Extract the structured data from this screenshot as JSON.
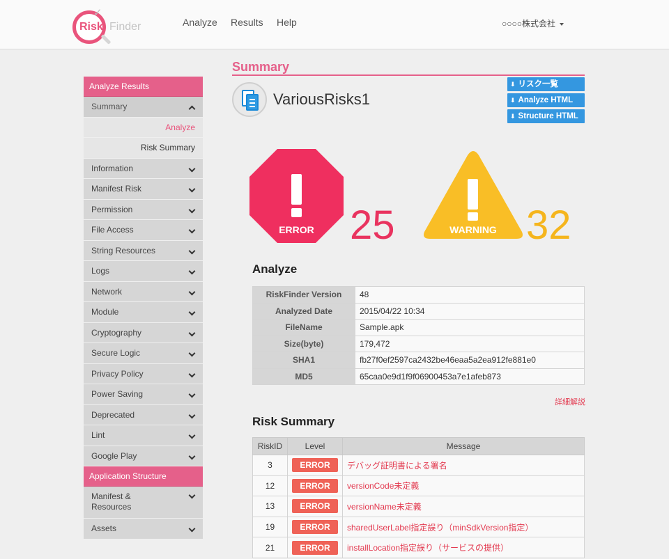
{
  "nav": {
    "logo_risk": "Risk",
    "logo_finder": "Finder",
    "links": [
      "Analyze",
      "Results",
      "Help"
    ],
    "company": "○○○○株式会社"
  },
  "sidebar": {
    "section1": "Analyze Results",
    "summary": "Summary",
    "sub_analyze": "Analyze",
    "sub_risk_summary": "Risk Summary",
    "items": [
      "Information",
      "Manifest Risk",
      "Permission",
      "File Access",
      "String Resources",
      "Logs",
      "Network",
      "Module",
      "Cryptography",
      "Secure Logic",
      "Privacy Policy",
      "Power Saving",
      "Deprecated",
      "Lint",
      "Google Play"
    ],
    "section2": "Application Structure",
    "items2": [
      "Manifest & Resources",
      "Assets"
    ]
  },
  "main": {
    "title": "Summary",
    "app_name": "VariousRisks1",
    "buttons": [
      "リスク一覧",
      "Analyze HTML",
      "Structure HTML"
    ],
    "error_label": "ERROR",
    "error_count": "25",
    "warning_label": "WARNING",
    "warning_count": "32",
    "analyze_heading": "Analyze",
    "analyze_rows": [
      {
        "key": "RiskFinder Version",
        "value": "48"
      },
      {
        "key": "Analyzed Date",
        "value": "2015/04/22 10:34"
      },
      {
        "key": "FileName",
        "value": "Sample.apk"
      },
      {
        "key": "Size(byte)",
        "value": "179,472"
      },
      {
        "key": "SHA1",
        "value": "fb27f0ef2597ca2432be46eaa5a2ea912fe881e0"
      },
      {
        "key": "MD5",
        "value": "65caa0e9d1f9f06900453a7e1afeb873"
      }
    ],
    "detail_link": "詳細解説",
    "risk_heading": "Risk Summary",
    "risk_columns": [
      "RiskID",
      "Level",
      "Message"
    ],
    "risk_rows": [
      {
        "id": "3",
        "level": "ERROR",
        "message": "デバッグ証明書による署名"
      },
      {
        "id": "12",
        "level": "ERROR",
        "message": "versionCode未定義"
      },
      {
        "id": "13",
        "level": "ERROR",
        "message": "versionName未定義"
      },
      {
        "id": "19",
        "level": "ERROR",
        "message": "sharedUserLabel指定誤り（minSdkVersion指定）"
      },
      {
        "id": "21",
        "level": "ERROR",
        "message": "installLocation指定誤り（サービスの提供）"
      }
    ]
  },
  "colors": {
    "brand_pink": "#e5608a",
    "error_red": "#e9335f",
    "warning_yellow": "#f5b51d",
    "button_blue": "#3497e0",
    "badge_red": "#ef6257"
  }
}
